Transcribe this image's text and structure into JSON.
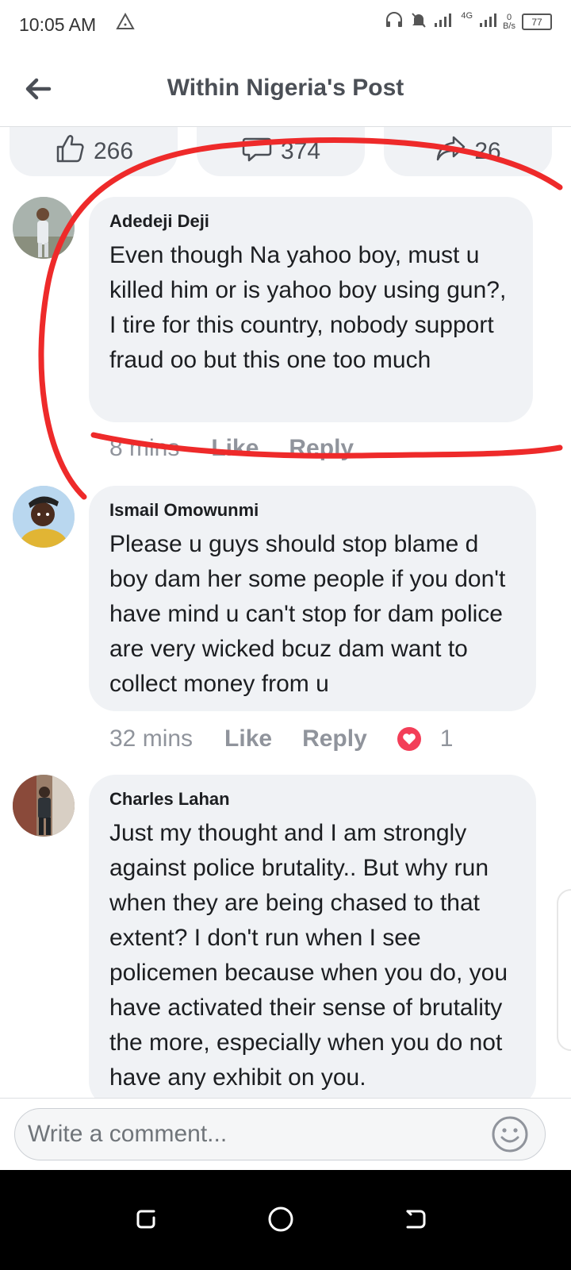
{
  "status_bar": {
    "time": "10:05 AM",
    "network": "4G",
    "speed_value": "0",
    "speed_unit": "B/s",
    "battery": "77"
  },
  "header": {
    "title": "Within Nigeria's Post"
  },
  "reactions": {
    "likes": "266",
    "comments": "374",
    "shares": "26"
  },
  "comments": [
    {
      "author": "Adedeji Deji",
      "text": "Even though Na yahoo boy, must u killed him or is yahoo boy using gun?, I tire for this country, nobody support fraud oo but this one too much",
      "time": "8 mins",
      "like": "Like",
      "reply": "Reply"
    },
    {
      "author": "Ismail Omowunmi",
      "text": "Please u guys should stop blame d boy dam her some people if you don't have mind u can't stop for dam police are very wicked bcuz dam want to collect money from u",
      "time": "32 mins",
      "like": "Like",
      "reply": "Reply",
      "reaction_count": "1"
    },
    {
      "author": "Charles Lahan",
      "text": "Just my thought and I am strongly against police brutality.. But why run when they are being chased to that extent? I don't run when I see policemen because when you do, you have activated their sense of brutality the more, especially when you do not have any exhibit on you."
    }
  ],
  "composer": {
    "placeholder": "Write a comment..."
  },
  "colors": {
    "annotation": "#ee2a2a",
    "bubble": "#f0f2f5",
    "heart": "#f33e58"
  }
}
